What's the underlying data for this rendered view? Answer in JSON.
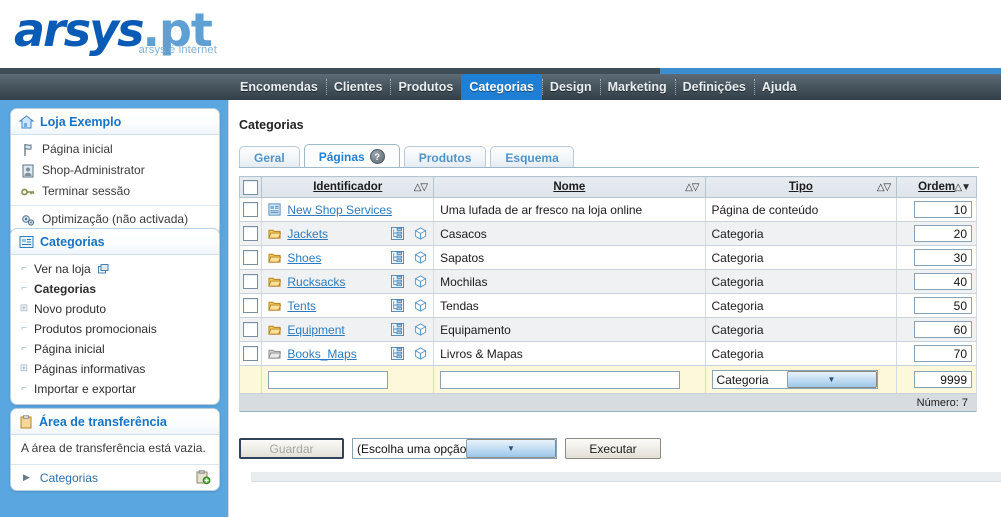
{
  "brand": {
    "name": "arsys",
    "tld": ".pt",
    "tagline": "arsys é internet",
    "logo_color": "#0a5bb5",
    "accent_color": "#1e7fd4"
  },
  "nav": {
    "items": [
      {
        "label": "Encomendas",
        "active": false
      },
      {
        "label": "Clientes",
        "active": false
      },
      {
        "label": "Produtos",
        "active": false
      },
      {
        "label": "Categorias",
        "active": true
      },
      {
        "label": "Design",
        "active": false
      },
      {
        "label": "Marketing",
        "active": false
      },
      {
        "label": "Definições",
        "active": false
      },
      {
        "label": "Ajuda",
        "active": false
      }
    ]
  },
  "sidebar": {
    "shop_panel": {
      "title": "Loja Exemplo",
      "icon": "house-icon",
      "links": [
        {
          "label": "Página inicial",
          "icon": "flag-icon"
        },
        {
          "label": "Shop-Administrator",
          "icon": "user-icon"
        },
        {
          "label": "Terminar sessão",
          "icon": "key-icon"
        }
      ],
      "footer_link": {
        "label": "Optimização (não activada)",
        "icon": "gears-icon"
      }
    },
    "categories_panel": {
      "title": "Categorias",
      "icon": "category-icon",
      "items": [
        {
          "label": "Ver na loja",
          "expandable": false,
          "selected": false,
          "external": true
        },
        {
          "label": "Categorias",
          "expandable": false,
          "selected": true,
          "external": false
        },
        {
          "label": "Novo produto",
          "expandable": true,
          "selected": false,
          "external": false
        },
        {
          "label": "Produtos promocionais",
          "expandable": false,
          "selected": false,
          "external": false
        },
        {
          "label": "Página inicial",
          "expandable": false,
          "selected": false,
          "external": false
        },
        {
          "label": "Páginas informativas",
          "expandable": true,
          "selected": false,
          "external": false
        },
        {
          "label": "Importar e exportar",
          "expandable": false,
          "selected": false,
          "external": false
        }
      ]
    },
    "clipboard_panel": {
      "title": "Área de transferência",
      "icon": "clipboard-icon",
      "empty_text": "A área de transferência está vazia.",
      "row_label": "Categorias",
      "row_icon": "clipboard-add-icon"
    }
  },
  "main": {
    "breadcrumb": "Categorias",
    "tabs": [
      {
        "label": "Geral",
        "active": false,
        "help": false
      },
      {
        "label": "Páginas",
        "active": true,
        "help": true,
        "help_glyph": "?"
      },
      {
        "label": "Produtos",
        "active": false,
        "help": false
      },
      {
        "label": "Esquema",
        "active": false,
        "help": false
      }
    ],
    "table": {
      "columns": [
        {
          "label": "Identificador",
          "sort": "none"
        },
        {
          "label": "Nome",
          "sort": "none"
        },
        {
          "label": "Tipo",
          "sort": "none"
        },
        {
          "label": "Ordem",
          "sort": "desc"
        }
      ],
      "select_all_checked": false,
      "rows": [
        {
          "checked": false,
          "icon": "page-icon",
          "id": "New Shop Services",
          "has_tools": false,
          "name": "Uma lufada de ar fresco na loja online",
          "type": "Página de conteúdo",
          "order": "10"
        },
        {
          "checked": false,
          "icon": "folder-icon",
          "id": "Jackets",
          "has_tools": true,
          "name": "Casacos",
          "type": "Categoria",
          "order": "20"
        },
        {
          "checked": false,
          "icon": "folder-icon",
          "id": "Shoes",
          "has_tools": true,
          "name": "Sapatos",
          "type": "Categoria",
          "order": "30"
        },
        {
          "checked": false,
          "icon": "folder-icon",
          "id": "Rucksacks",
          "has_tools": true,
          "name": "Mochilas",
          "type": "Categoria",
          "order": "40"
        },
        {
          "checked": false,
          "icon": "folder-icon",
          "id": "Tents",
          "has_tools": true,
          "name": "Tendas",
          "type": "Categoria",
          "order": "50"
        },
        {
          "checked": false,
          "icon": "folder-icon",
          "id": "Equipment",
          "has_tools": true,
          "name": "Equipamento",
          "type": "Categoria",
          "order": "60"
        },
        {
          "checked": false,
          "icon": "folder-grey-icon",
          "id": "Books_Maps",
          "has_tools": true,
          "name": "Livros & Mapas",
          "type": "Categoria",
          "order": "70"
        }
      ],
      "new_row": {
        "id_value": "",
        "id_placeholder": "",
        "name_value": "",
        "name_placeholder": "",
        "type_value": "Categoria",
        "order_value": "9999"
      },
      "footer": "Número: 7"
    },
    "actions": {
      "save_label": "Guardar",
      "save_disabled": true,
      "select_value": "(Escolha uma opção)",
      "execute_label": "Executar"
    }
  }
}
